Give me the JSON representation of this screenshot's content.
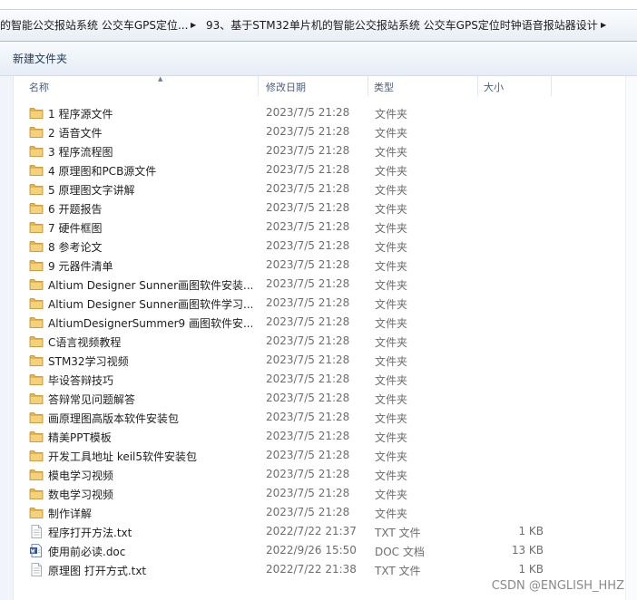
{
  "breadcrumb": {
    "segments": [
      "的智能公交报站系统 公交车GPS定位...",
      "93、基于STM32单片机的智能公交报站系统 公交车GPS定位时钟语音报站器设计"
    ]
  },
  "toolbar": {
    "new_folder_label": "新建文件夹"
  },
  "columns": {
    "name": "名称",
    "date": "修改日期",
    "type": "类型",
    "size": "大小"
  },
  "files": [
    {
      "name": "1 程序源文件",
      "date": "2023/7/5 21:28",
      "type": "文件夹",
      "size": "",
      "icon": "folder-icon"
    },
    {
      "name": "2 语音文件",
      "date": "2023/7/5 21:28",
      "type": "文件夹",
      "size": "",
      "icon": "folder-icon"
    },
    {
      "name": "3 程序流程图",
      "date": "2023/7/5 21:28",
      "type": "文件夹",
      "size": "",
      "icon": "folder-icon"
    },
    {
      "name": "4 原理图和PCB源文件",
      "date": "2023/7/5 21:28",
      "type": "文件夹",
      "size": "",
      "icon": "folder-icon"
    },
    {
      "name": "5 原理图文字讲解",
      "date": "2023/7/5 21:28",
      "type": "文件夹",
      "size": "",
      "icon": "folder-icon"
    },
    {
      "name": "6 开题报告",
      "date": "2023/7/5 21:28",
      "type": "文件夹",
      "size": "",
      "icon": "folder-icon"
    },
    {
      "name": "7 硬件框图",
      "date": "2023/7/5 21:28",
      "type": "文件夹",
      "size": "",
      "icon": "folder-icon"
    },
    {
      "name": "8 参考论文",
      "date": "2023/7/5 21:28",
      "type": "文件夹",
      "size": "",
      "icon": "folder-icon"
    },
    {
      "name": "9 元器件清单",
      "date": "2023/7/5 21:28",
      "type": "文件夹",
      "size": "",
      "icon": "folder-icon"
    },
    {
      "name": "Altium Designer Sunner画图软件安装...",
      "date": "2023/7/5 21:28",
      "type": "文件夹",
      "size": "",
      "icon": "folder-icon"
    },
    {
      "name": "Altium Designer Sunner画图软件学习...",
      "date": "2023/7/5 21:28",
      "type": "文件夹",
      "size": "",
      "icon": "folder-icon"
    },
    {
      "name": "AltiumDesignerSummer9 画图软件安...",
      "date": "2023/7/5 21:28",
      "type": "文件夹",
      "size": "",
      "icon": "folder-icon"
    },
    {
      "name": "C语言视频教程",
      "date": "2023/7/5 21:28",
      "type": "文件夹",
      "size": "",
      "icon": "folder-icon"
    },
    {
      "name": "STM32学习视频",
      "date": "2023/7/5 21:28",
      "type": "文件夹",
      "size": "",
      "icon": "folder-icon"
    },
    {
      "name": "毕设答辩技巧",
      "date": "2023/7/5 21:28",
      "type": "文件夹",
      "size": "",
      "icon": "folder-icon"
    },
    {
      "name": "答辩常见问题解答",
      "date": "2023/7/5 21:28",
      "type": "文件夹",
      "size": "",
      "icon": "folder-icon"
    },
    {
      "name": "画原理图高版本软件安装包",
      "date": "2023/7/5 21:28",
      "type": "文件夹",
      "size": "",
      "icon": "folder-icon"
    },
    {
      "name": "精美PPT模板",
      "date": "2023/7/5 21:28",
      "type": "文件夹",
      "size": "",
      "icon": "folder-icon"
    },
    {
      "name": "开发工具地址 keil5软件安装包",
      "date": "2023/7/5 21:28",
      "type": "文件夹",
      "size": "",
      "icon": "folder-icon"
    },
    {
      "name": "模电学习视频",
      "date": "2023/7/5 21:28",
      "type": "文件夹",
      "size": "",
      "icon": "folder-icon"
    },
    {
      "name": "数电学习视频",
      "date": "2023/7/5 21:28",
      "type": "文件夹",
      "size": "",
      "icon": "folder-icon"
    },
    {
      "name": "制作详解",
      "date": "2023/7/5 21:28",
      "type": "文件夹",
      "size": "",
      "icon": "folder-icon"
    },
    {
      "name": "程序打开方法.txt",
      "date": "2022/7/22 21:37",
      "type": "TXT 文件",
      "size": "1 KB",
      "icon": "text-file-icon"
    },
    {
      "name": "使用前必读.doc",
      "date": "2022/9/26 15:50",
      "type": "DOC 文档",
      "size": "13 KB",
      "icon": "word-doc-icon"
    },
    {
      "name": "原理图 打开方式.txt",
      "date": "2022/7/22 21:38",
      "type": "TXT 文件",
      "size": "1 KB",
      "icon": "text-file-icon"
    }
  ],
  "watermark": "CSDN @ENGLISH_HHZ",
  "colors": {
    "folder": "#e8b545",
    "accent": "#1e395b",
    "muted": "#6d6d6d"
  }
}
